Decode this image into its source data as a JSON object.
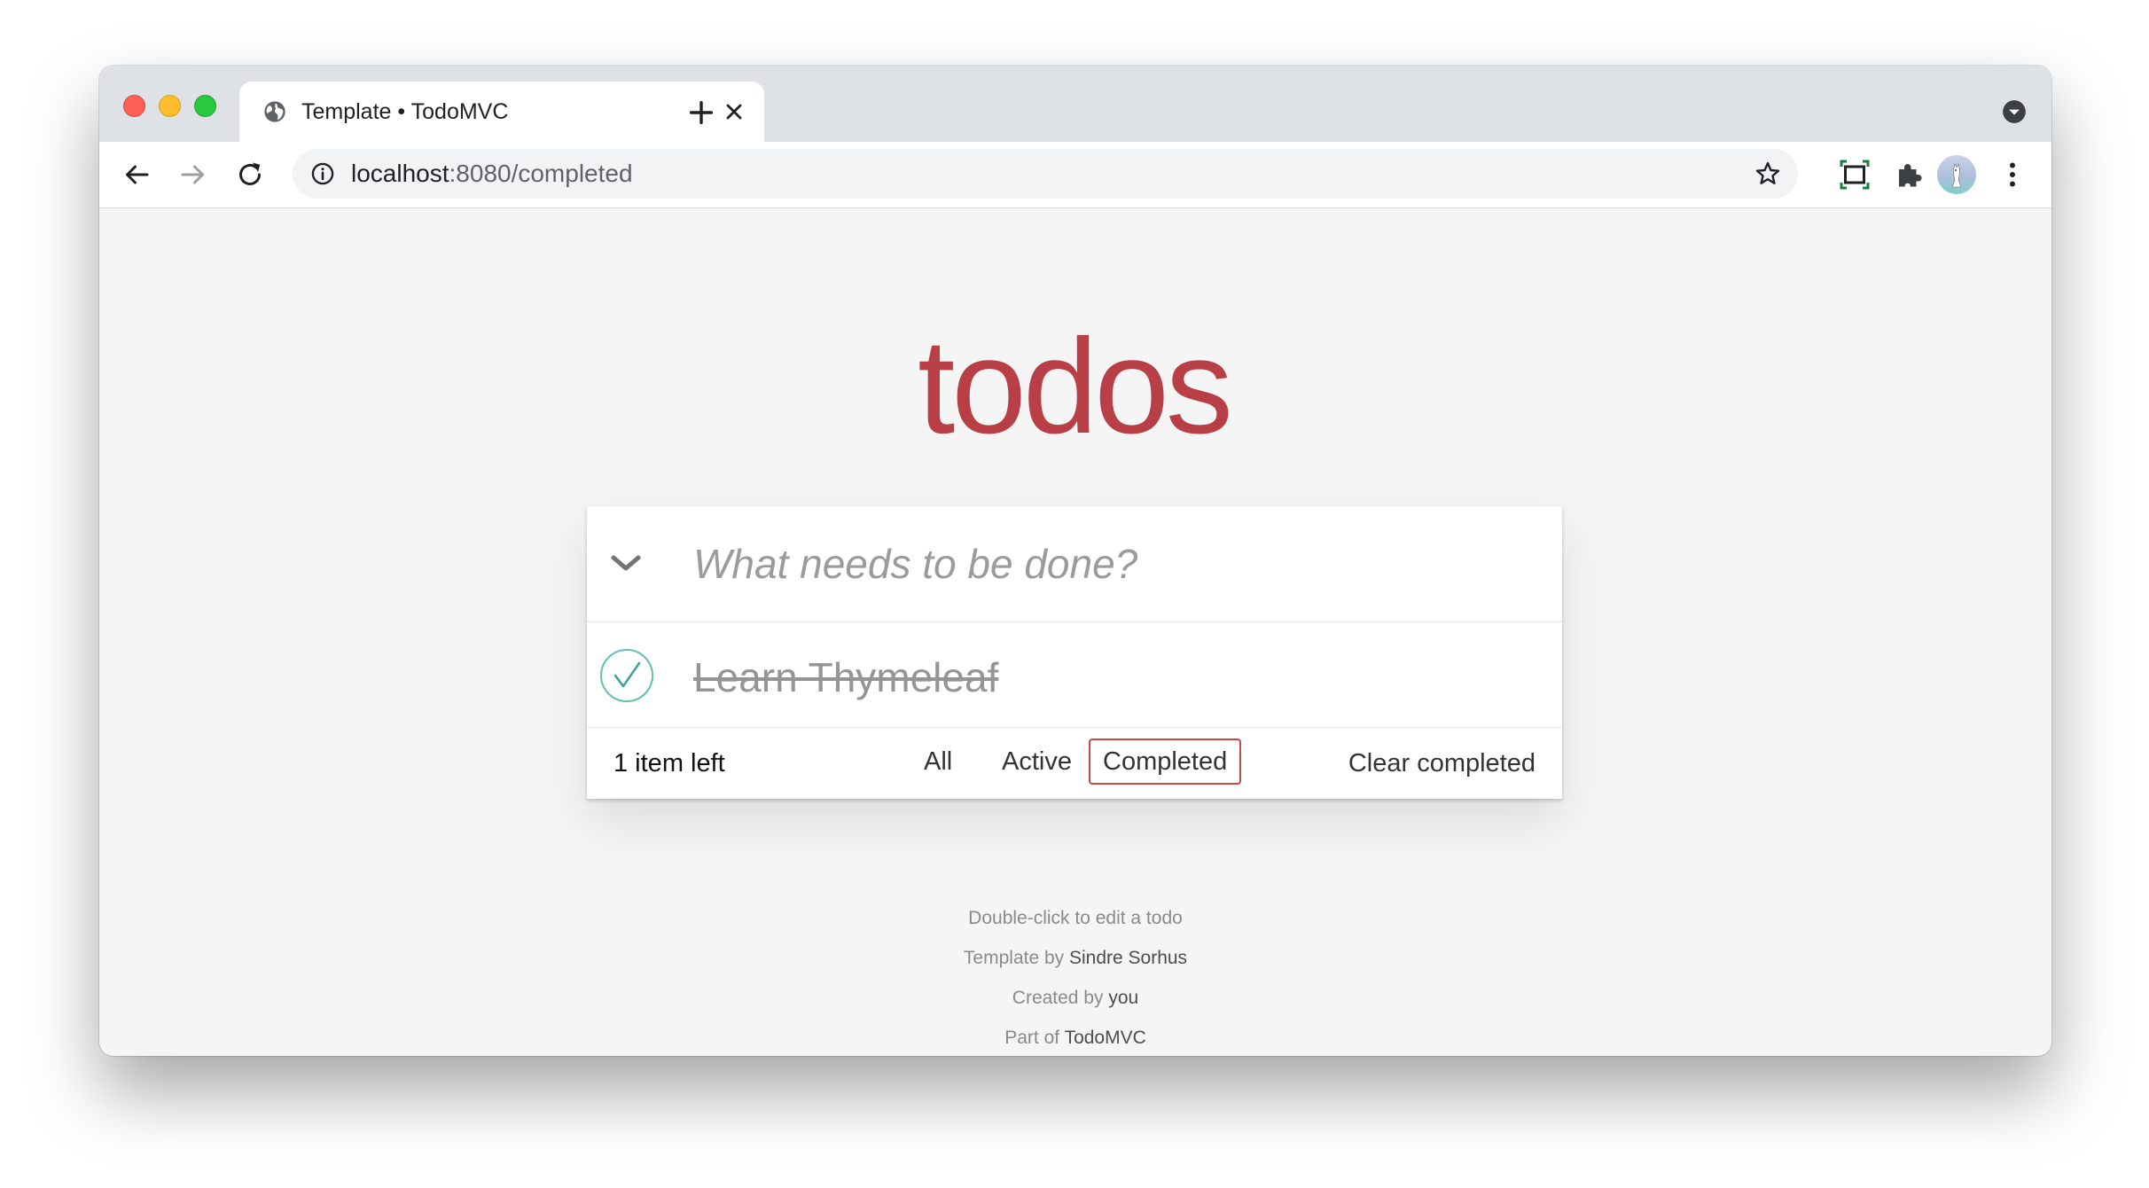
{
  "browser": {
    "tab_title": "Template • TodoMVC",
    "url_host": "localhost",
    "url_rest": ":8080/completed"
  },
  "app": {
    "title": "todos",
    "new_todo_placeholder": "What needs to be done?",
    "items": [
      {
        "label": "Learn Thymeleaf",
        "completed": true
      }
    ],
    "footer": {
      "count_text": "1 item left",
      "filters": [
        "All",
        "Active",
        "Completed"
      ],
      "selected_filter": "Completed",
      "clear_label": "Clear completed"
    }
  },
  "info": {
    "line1": "Double-click to edit a todo",
    "line2_prefix": "Template by ",
    "line2_link": "Sindre Sorhus",
    "line3_prefix": "Created by ",
    "line3_link": "you",
    "line4_prefix": "Part of ",
    "line4_link": "TodoMVC"
  },
  "colors": {
    "title": "#b83f45",
    "selected_filter_border": "#ce4646",
    "check": "#3ea390"
  }
}
